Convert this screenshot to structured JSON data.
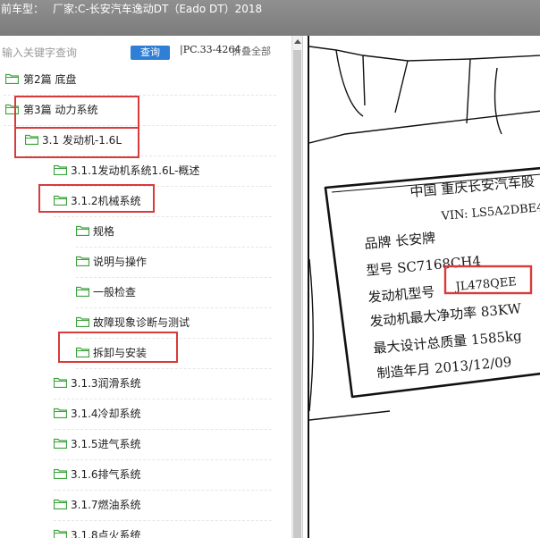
{
  "window": {
    "title_prefix": "前车型：",
    "title_model": "厂家:C-长安汽车逸动DT（Eado DT）2018"
  },
  "search": {
    "placeholder": "输入关键字查询",
    "button_label": "查询",
    "code": "|PC.33-4264",
    "collapse_label": "折叠全部"
  },
  "tree": {
    "items": [
      {
        "label": "第2篇 底盘"
      },
      {
        "label": "第3篇 动力系统"
      },
      {
        "label": "3.1 发动机-1.6L"
      },
      {
        "label": "3.1.1发动机系统1.6L-概述"
      },
      {
        "label": "3.1.2机械系统"
      },
      {
        "label": "规格"
      },
      {
        "label": "说明与操作"
      },
      {
        "label": "一般检查"
      },
      {
        "label": "故障现象诊断与测试"
      },
      {
        "label": "拆卸与安装"
      },
      {
        "label": "3.1.3润滑系统"
      },
      {
        "label": "3.1.4冷却系统"
      },
      {
        "label": "3.1.5进气系统"
      },
      {
        "label": "3.1.6排气系统"
      },
      {
        "label": "3.1.7燃油系统"
      },
      {
        "label": "3.1.8点火系统"
      }
    ]
  },
  "nameplate": {
    "line1": "中国  重庆长安汽车股",
    "line2": "VIN: LS5A2DBE4",
    "line3": "品牌  长安牌",
    "line4": "型号  SC7168CH4",
    "line5_label": "发动机型号",
    "line5_value": "JL478QEE",
    "line6": "发动机最大净功率  83KW",
    "line7": "最大设计总质量  1585kg",
    "line8": "制造年月  2013/12/09"
  },
  "colors": {
    "highlight": "#d93a3a",
    "folder": "#3aa33a",
    "search_button": "#2f7fd6"
  }
}
